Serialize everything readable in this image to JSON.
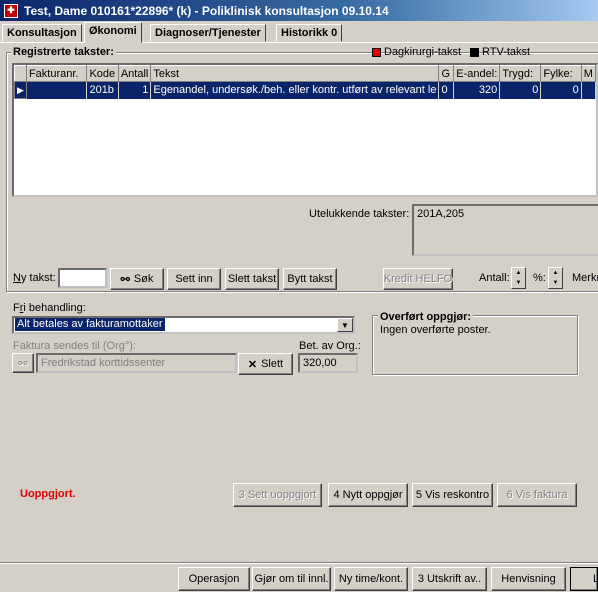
{
  "window": {
    "title": "Test, Dame  010161*22896* (k) - Poliklinisk konsultasjon 09.10.14"
  },
  "tabs": [
    {
      "label": "Konsultasjon"
    },
    {
      "label": "Økonomi"
    },
    {
      "label": "Diagnoser/Tjenester"
    },
    {
      "label": "Historikk 0"
    }
  ],
  "registrerte": {
    "title": "Registrerte takster:",
    "legend_dagkirurgi": "Dagkirurgi-takst",
    "legend_rtv": "RTV-takst",
    "legend_dagkirurgi_color": "#e00000",
    "legend_rtv_color": "#000000",
    "columns": [
      "Fakturanr.",
      "Kode",
      "Antall",
      "Tekst",
      "G",
      "E-andel:",
      "Trygd:",
      "Fylke:",
      "M"
    ],
    "rows": [
      {
        "fakturanr": "",
        "kode": "201b",
        "antall": "1",
        "tekst": "Egenandel, undersøk./beh. eller kontr. utført av relevant le",
        "g": "0",
        "eandel": "320",
        "trygd": "0",
        "fylke": "0",
        "m": ""
      }
    ]
  },
  "utelukkende": {
    "label": "Utelukkende takster:",
    "value": "201A,205"
  },
  "taksttoolbar": {
    "ny_takst_label": "Ny takst:",
    "ny_takst_value": "",
    "sok": "Søk",
    "sett_inn": "Sett inn",
    "slett_takst": "Slett takst",
    "bytt_takst": "Bytt takst",
    "kredit_helfo": "Kredit HELFO",
    "antall_label": "Antall:",
    "prosent_label": "%:",
    "merknad_label": "Merkn"
  },
  "fri_behandling": {
    "label": "Fri behandling:",
    "selected": "Alt betales av fakturamottaker"
  },
  "faktura": {
    "label": "Faktura sendes til (Org°):",
    "value": "Fredrikstad korttidssenter",
    "slett": "Slett",
    "bet_label": "Bet. av Org.:",
    "bet_value": "320,00"
  },
  "overfort": {
    "title": "Overført oppgjør:",
    "text": "Ingen overførte poster."
  },
  "status": {
    "text": "Uoppgjort.",
    "color": "#e00000"
  },
  "oppgjor_buttons": {
    "sett_uoppgjort": "3 Sett uoppgjort",
    "nytt_oppgjor": "4 Nytt oppgjør",
    "vis_reskontro": "5 Vis reskontro",
    "vis_faktura": "6 Vis faktura"
  },
  "bottom_buttons": {
    "operasjon": "Operasjon",
    "gjor_om": "Gjør om til innl.",
    "ny_time": "Ny time/kont.",
    "utskrift": "3 Utskrift av..",
    "henvisning": "Henvisning",
    "last": "L"
  }
}
